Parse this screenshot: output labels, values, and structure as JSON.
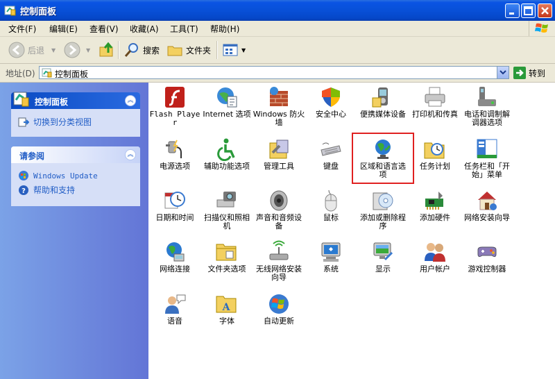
{
  "window": {
    "title": "控制面板"
  },
  "menu": [
    "文件(F)",
    "编辑(E)",
    "查看(V)",
    "收藏(A)",
    "工具(T)",
    "帮助(H)"
  ],
  "toolbar": {
    "back": "后退",
    "search": "搜索",
    "folders": "文件夹"
  },
  "address": {
    "label": "地址(D)",
    "value": "控制面板",
    "go": "转到"
  },
  "left": {
    "panel1": {
      "title": "控制面板",
      "link": "切换到分类视图"
    },
    "panel2": {
      "title": "请参阅",
      "links": [
        "Windows Update",
        "帮助和支持"
      ]
    }
  },
  "items": [
    "Flash Player",
    "Internet 选项",
    "Windows 防火墙",
    "安全中心",
    "便携媒体设备",
    "打印机和传真",
    "电话和调制解调器选项",
    "电源选项",
    "辅助功能选项",
    "管理工具",
    "键盘",
    "区域和语言选项",
    "任务计划",
    "任务栏和「开始」菜单",
    "日期和时间",
    "扫描仪和照相机",
    "声音和音频设备",
    "鼠标",
    "添加或删除程序",
    "添加硬件",
    "网络安装向导",
    "网络连接",
    "文件夹选项",
    "无线网络安装向导",
    "系统",
    "显示",
    "用户帐户",
    "游戏控制器",
    "语音",
    "字体",
    "自动更新"
  ]
}
